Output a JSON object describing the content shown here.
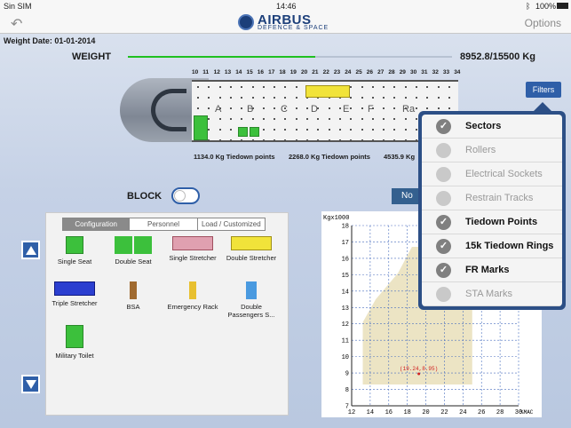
{
  "status_bar": {
    "carrier": "Sin SIM",
    "time": "14:46",
    "battery": "100%"
  },
  "nav": {
    "back_icon": "back-arrow-icon",
    "logo_name": "AIRBUS",
    "logo_sub": "DEFENCE & SPACE",
    "options": "Options"
  },
  "weight": {
    "date": "Weight Date: 01-01-2014",
    "label": "WEIGHT",
    "current": 8952.8,
    "max": 15500,
    "value_text": "8952.8/15500 Kg"
  },
  "aircraft": {
    "frames": [
      "10",
      "11",
      "12",
      "13",
      "14",
      "15",
      "16",
      "17",
      "18",
      "19",
      "20",
      "21",
      "22",
      "23",
      "24",
      "25",
      "26",
      "27",
      "28",
      "29",
      "30",
      "31",
      "32",
      "33",
      "34"
    ],
    "sectors": [
      "A",
      "B",
      "C",
      "D",
      "E",
      "F",
      "Ra"
    ]
  },
  "tiedown_legend": [
    "1134.0 Kg Tiedown points",
    "2268.0 Kg Tiedown points",
    "4535.9 Kg"
  ],
  "filters": {
    "button": "Filters",
    "items": [
      {
        "label": "Sectors",
        "checked": true
      },
      {
        "label": "Rollers",
        "checked": false
      },
      {
        "label": "Electrical Sockets",
        "checked": false
      },
      {
        "label": "Restrain Tracks",
        "checked": false
      },
      {
        "label": "Tiedown Points",
        "checked": true
      },
      {
        "label": "15k Tiedown Rings",
        "checked": true
      },
      {
        "label": "FR Marks",
        "checked": true
      },
      {
        "label": "STA Marks",
        "checked": false
      }
    ]
  },
  "block": {
    "label": "BLOCK",
    "on": false
  },
  "no_button": "No",
  "palette": {
    "tabs": [
      "Configuration",
      "Personnel",
      "Load / Customized"
    ],
    "active_tab": 0,
    "items": [
      {
        "label": "Single Seat",
        "icon": "single-seat-icon",
        "color": "#3cc03c"
      },
      {
        "label": "Double Seat",
        "icon": "double-seat-icon",
        "color": "#3cc03c"
      },
      {
        "label": "Single Stretcher",
        "icon": "single-stretcher-icon",
        "color": "#e0a0b0"
      },
      {
        "label": "Double Stretcher",
        "icon": "double-stretcher-icon",
        "color": "#f1e33a"
      },
      {
        "label": "Triple Stretcher",
        "icon": "triple-stretcher-icon",
        "color": "#2b3fd0"
      },
      {
        "label": "BSA",
        "icon": "bsa-icon",
        "color": "#a06a30"
      },
      {
        "label": "Emergency Rack",
        "icon": "emergency-rack-icon",
        "color": "#e8c030"
      },
      {
        "label": "Double Passengers S...",
        "icon": "double-passenger-seat-icon",
        "color": "#4a9ae0"
      },
      {
        "label": "Military Toilet",
        "icon": "military-toilet-icon",
        "color": "#3cc03c"
      }
    ]
  },
  "chart_data": {
    "type": "area",
    "title": "",
    "ylabel": "Kgx1000",
    "xlabel": "%MAC",
    "xlim": [
      12,
      30
    ],
    "ylim": [
      7,
      18
    ],
    "xticks": [
      12,
      14,
      16,
      18,
      20,
      22,
      24,
      26,
      28,
      30
    ],
    "yticks": [
      7,
      8,
      9,
      10,
      11,
      12,
      13,
      14,
      15,
      16,
      17,
      18
    ],
    "grid": true,
    "envelope": {
      "x": [
        13.2,
        13.2,
        14.6,
        17,
        18.5,
        21.5,
        25,
        25,
        13.2
      ],
      "y": [
        8.3,
        12.1,
        13.5,
        15.1,
        16.7,
        16.7,
        12.9,
        8.3,
        8.3
      ]
    },
    "point": {
      "x": 19.24,
      "y": 8.95,
      "label": "(19.24,8.95)"
    }
  }
}
